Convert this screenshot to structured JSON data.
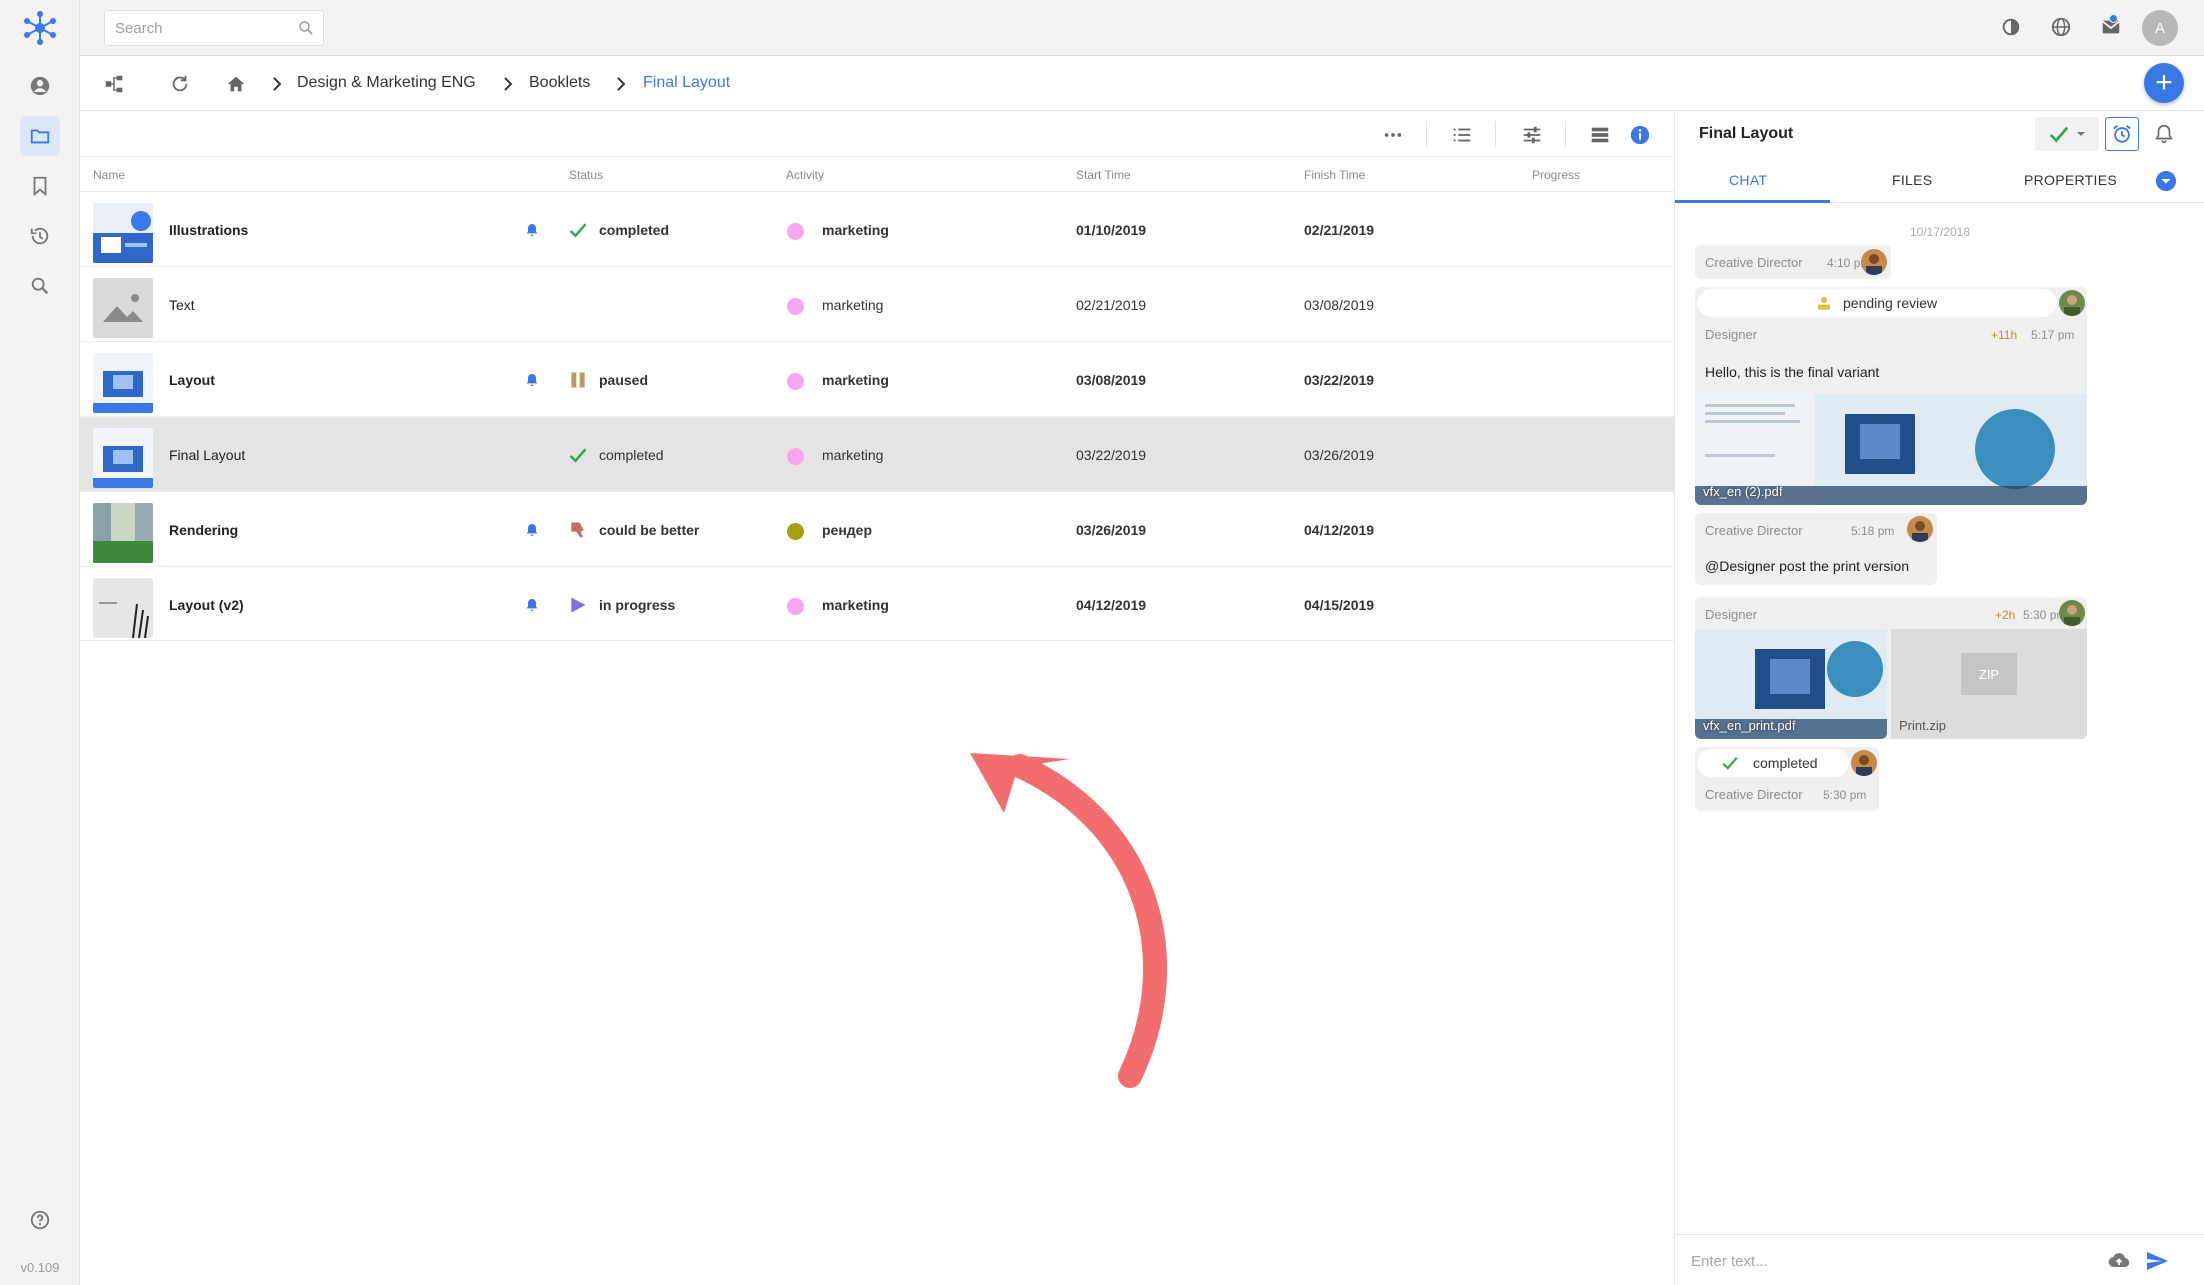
{
  "app": {
    "version": "v0.109"
  },
  "search": {
    "placeholder": "Search"
  },
  "user": {
    "initial": "A"
  },
  "breadcrumb": {
    "items": [
      "Design & Marketing ENG",
      "Booklets"
    ],
    "current": "Final Layout"
  },
  "table": {
    "headers": {
      "name": "Name",
      "status": "Status",
      "activity": "Activity",
      "start": "Start Time",
      "finish": "Finish Time",
      "progress": "Progress"
    },
    "rows": [
      {
        "name": "Illustrations",
        "status": "completed",
        "activity": "marketing",
        "start": "01/10/2019",
        "finish": "02/21/2019",
        "bold": true,
        "bell": true,
        "status_icon": "check-icon",
        "activity_color": "#f7a6ef"
      },
      {
        "name": "Text",
        "status": "",
        "activity": "marketing",
        "start": "02/21/2019",
        "finish": "03/08/2019",
        "bold": false,
        "bell": false,
        "status_icon": "",
        "activity_color": "#f7a6ef"
      },
      {
        "name": "Layout",
        "status": "paused",
        "activity": "marketing",
        "start": "03/08/2019",
        "finish": "03/22/2019",
        "bold": true,
        "bell": true,
        "status_icon": "pause-icon",
        "activity_color": "#f7a6ef"
      },
      {
        "name": "Final Layout",
        "status": "completed",
        "activity": "marketing",
        "start": "03/22/2019",
        "finish": "03/26/2019",
        "bold": false,
        "bell": false,
        "status_icon": "check-icon",
        "activity_color": "#f7a6ef"
      },
      {
        "name": "Rendering",
        "status": "could be better",
        "activity": "рендер",
        "start": "03/26/2019",
        "finish": "04/12/2019",
        "bold": true,
        "bell": true,
        "status_icon": "thumb-down-icon",
        "activity_color": "#a5a012"
      },
      {
        "name": "Layout (v2)",
        "status": "in progress",
        "activity": "marketing",
        "start": "04/12/2019",
        "finish": "04/15/2019",
        "bold": true,
        "bell": true,
        "status_icon": "play-icon",
        "activity_color": "#f7a6ef"
      }
    ]
  },
  "detail": {
    "title": "Final Layout",
    "tabs": [
      "CHAT",
      "FILES",
      "PROPERTIES"
    ],
    "chat": {
      "date": "10/17/2018",
      "messages": [
        {
          "role": "Creative Director",
          "time": "4:10 pm"
        },
        {
          "pill": "pending review",
          "role": "Designer",
          "plus": "+11h",
          "time": "5:17 pm",
          "text": "Hello, this is the final variant",
          "attachment": "vfx_en (2).pdf"
        },
        {
          "role": "Creative Director",
          "time": "5:18 pm",
          "text": "@Designer post the print version"
        },
        {
          "role": "Designer",
          "plus": "+2h",
          "time": "5:30 pm",
          "attachments": [
            "vfx_en_print.pdf",
            "Print.zip"
          ],
          "zip_label": "ZIP"
        },
        {
          "pill": "completed",
          "role": "Creative Director",
          "time": "5:30 pm"
        }
      ]
    },
    "input_placeholder": "Enter text..."
  },
  "colors": {
    "accent": "#3b78e7",
    "completed": "#34a853",
    "arrow": "#f26d6d"
  }
}
